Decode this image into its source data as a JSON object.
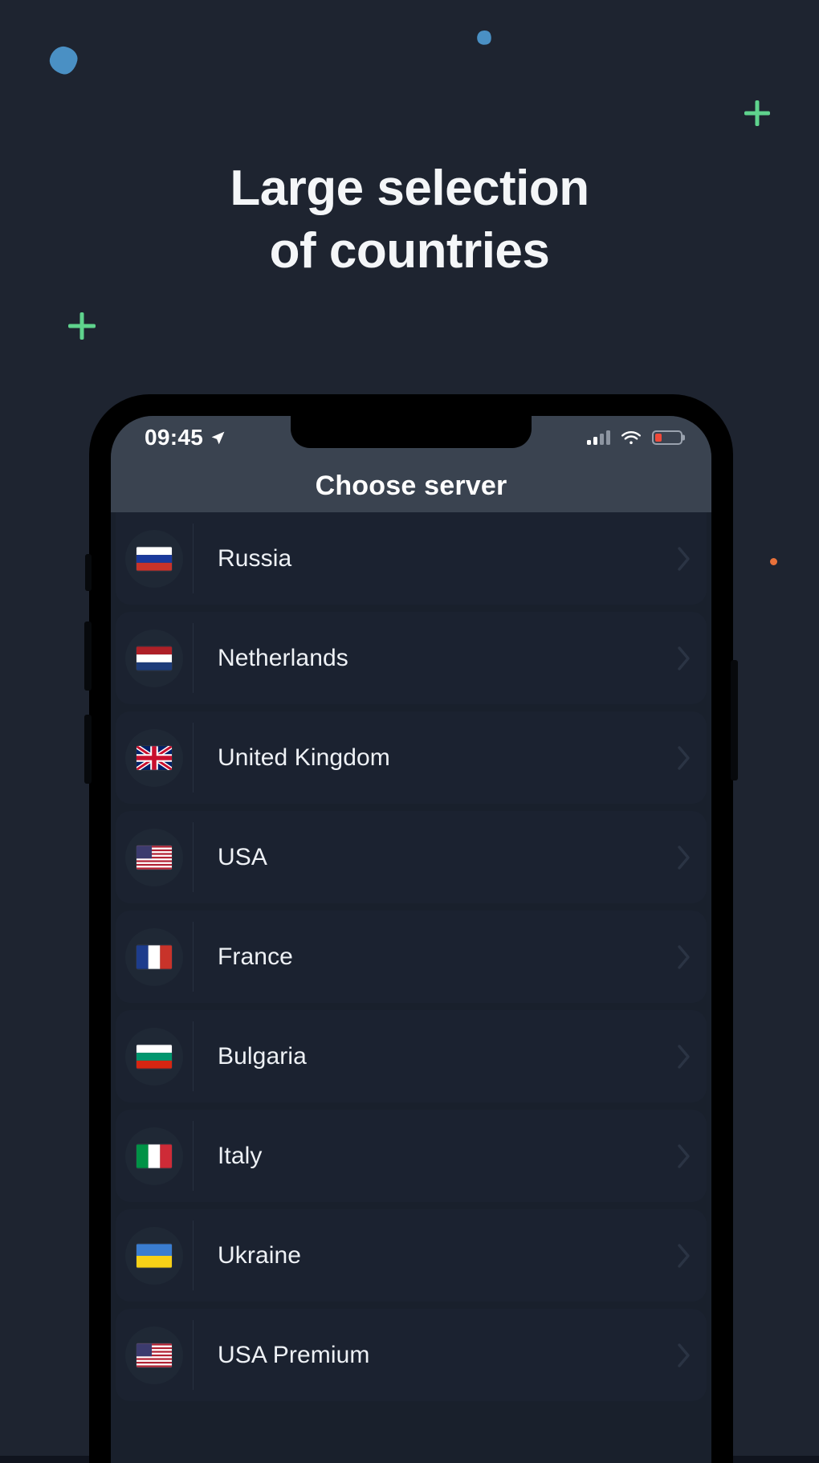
{
  "headline": {
    "line1": "Large selection",
    "line2": "of countries"
  },
  "decorations": {
    "blob_color": "#4a90c4",
    "plus_color": "#5fd38d",
    "dot_color": "#e8713a",
    "background_color": "#1e2430"
  },
  "phone": {
    "status_bar": {
      "time": "09:45",
      "location_icon": "location-arrow-icon",
      "signal_icon": "cellular-signal-icon",
      "signal_bars_filled": 2,
      "signal_bars_total": 4,
      "wifi_icon": "wifi-icon",
      "battery_icon": "battery-low-icon",
      "battery_level_percent": 26,
      "battery_color": "#f04a3a"
    },
    "header": {
      "title": "Choose server"
    },
    "server_list": {
      "chevron_icon": "chevron-right-icon",
      "items": [
        {
          "label": "Russia",
          "flag": "flag-ru"
        },
        {
          "label": "Netherlands",
          "flag": "flag-nl"
        },
        {
          "label": "United Kingdom",
          "flag": "flag-gb"
        },
        {
          "label": "USA",
          "flag": "flag-us"
        },
        {
          "label": "France",
          "flag": "flag-fr"
        },
        {
          "label": "Bulgaria",
          "flag": "flag-bg"
        },
        {
          "label": "Italy",
          "flag": "flag-it"
        },
        {
          "label": "Ukraine",
          "flag": "flag-ua"
        },
        {
          "label": "USA Premium",
          "flag": "flag-us"
        }
      ]
    }
  }
}
